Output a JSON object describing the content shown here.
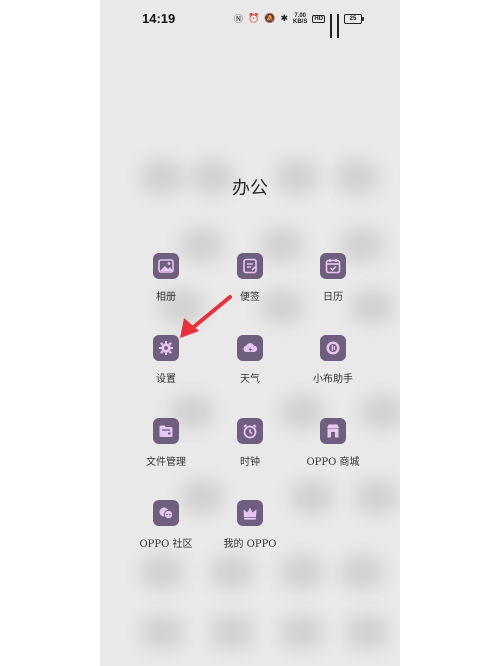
{
  "status_bar": {
    "time": "14:19",
    "net_speed_value": "7.00",
    "net_speed_unit": "KB/S",
    "hd_label": "HD",
    "battery": "25"
  },
  "folder": {
    "title": "办公",
    "apps": [
      {
        "label": "相册",
        "icon": "gallery-icon"
      },
      {
        "label": "便签",
        "icon": "notes-icon"
      },
      {
        "label": "日历",
        "icon": "calendar-icon"
      },
      {
        "label": "设置",
        "icon": "settings-gear-icon"
      },
      {
        "label": "天气",
        "icon": "weather-cloud-icon"
      },
      {
        "label": "小布助手",
        "icon": "assistant-icon"
      },
      {
        "label": "文件管理",
        "icon": "file-manager-icon"
      },
      {
        "label": "时钟",
        "icon": "clock-icon"
      },
      {
        "label": "OPPO 商城",
        "icon": "store-icon"
      },
      {
        "label": "OPPO 社区",
        "icon": "community-icon"
      },
      {
        "label": "我的 OPPO",
        "icon": "crown-icon"
      }
    ]
  },
  "colors": {
    "icon_bg": "#6f5f7e",
    "icon_glyph": "#e7c6ef",
    "annotation_arrow": "#e5323b",
    "background": "#e9e9e9"
  }
}
